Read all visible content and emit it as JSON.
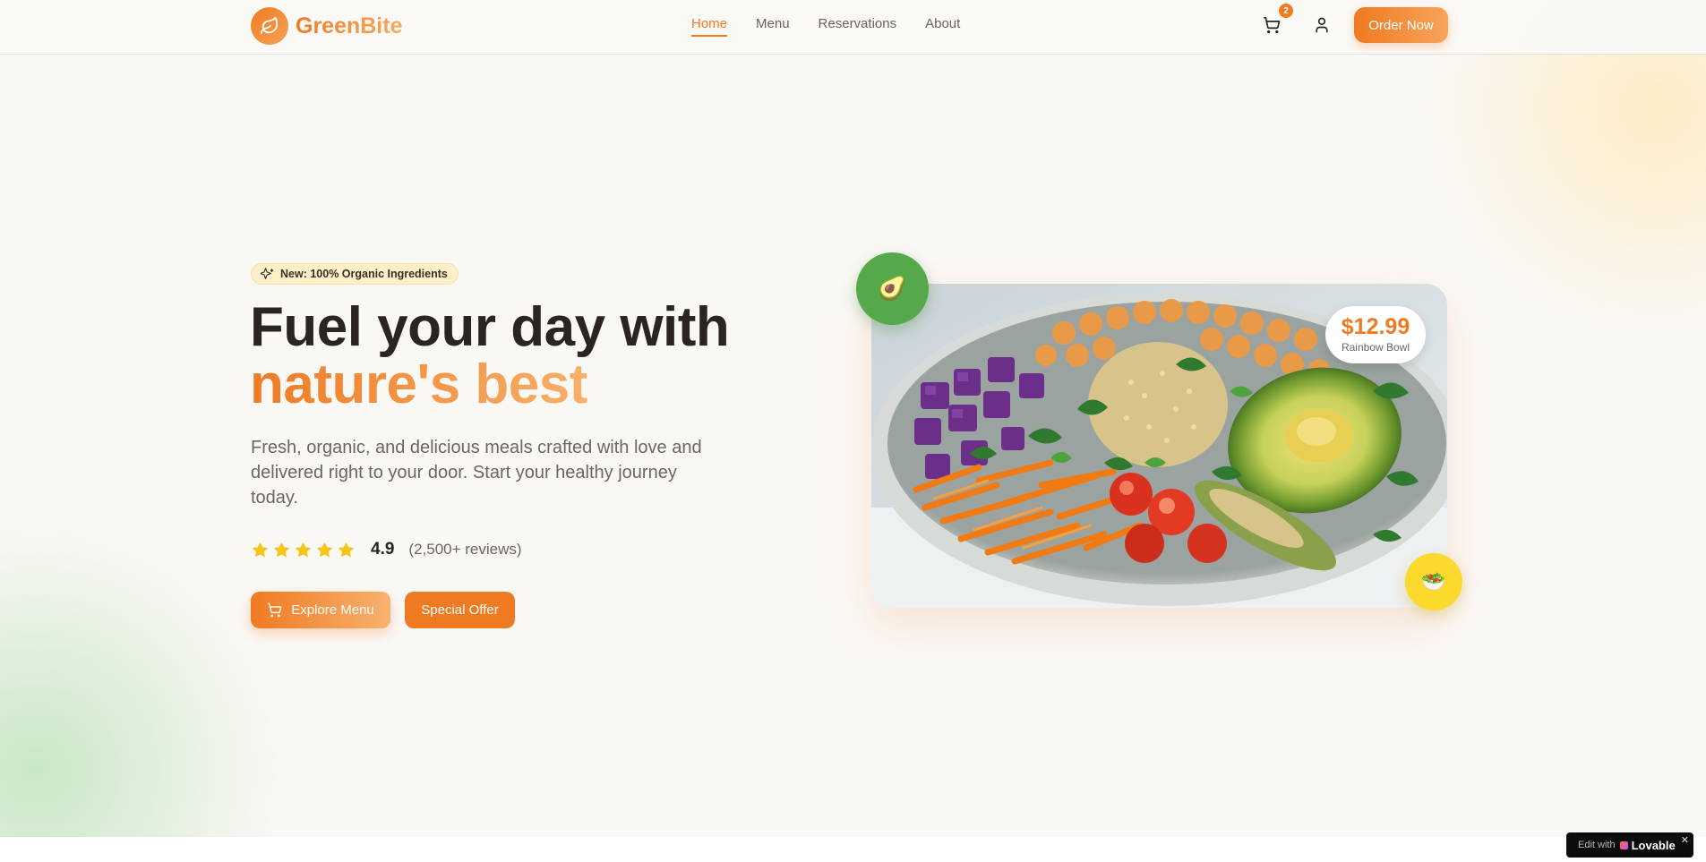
{
  "brand": {
    "name": "GreenBite",
    "logo_icon": "leaf-icon"
  },
  "nav": {
    "links": [
      {
        "label": "Home",
        "active": true
      },
      {
        "label": "Menu",
        "active": false
      },
      {
        "label": "Reservations",
        "active": false
      },
      {
        "label": "About",
        "active": false
      }
    ],
    "cart_count": "2",
    "order_label": "Order Now"
  },
  "hero": {
    "badge": "New: 100% Organic Ingredients",
    "headline_line1": "Fuel your day with",
    "headline_line2": "nature's best",
    "subtitle": "Fresh, organic, and delicious meals crafted with love and delivered right to your door. Start your healthy journey today.",
    "rating": {
      "stars": 5,
      "score": "4.9",
      "reviews": "(2,500+ reviews)"
    },
    "primary_cta": "Explore Menu",
    "secondary_cta": "Special Offer"
  },
  "feature_card": {
    "price": "$12.99",
    "name": "Rainbow Bowl",
    "float_top_emoji": "🥑",
    "float_bottom_emoji": "🥗"
  },
  "footer_badge": {
    "prefix": "Edit with",
    "brand": "Lovable",
    "close": "✕"
  },
  "colors": {
    "accent": "#ef7a24",
    "accent_light": "#f7b06a",
    "text": "#2a2521",
    "muted": "#6e655e",
    "background": "#faf8f5",
    "star": "#f9c418",
    "green_bubble": "#56a94a",
    "yellow_bubble": "#fbd92d"
  }
}
